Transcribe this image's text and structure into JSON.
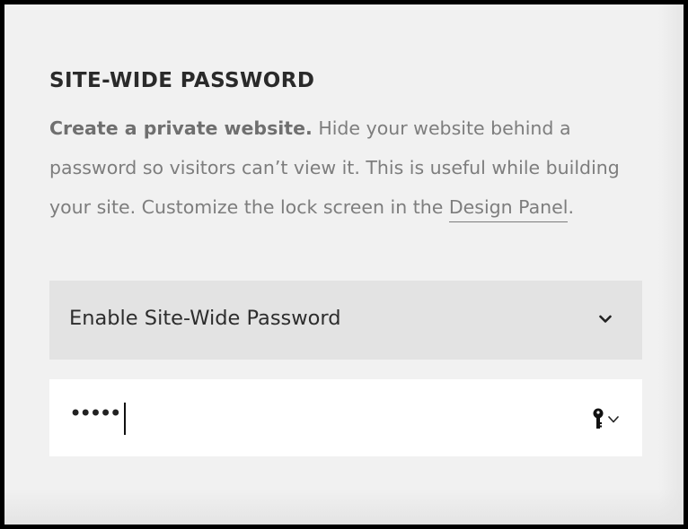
{
  "section": {
    "title": "SITE-WIDE PASSWORD",
    "description_strong": "Create a private website.",
    "description_text": " Hide your website behind a password so visitors can’t view it. This is useful while building your site. Customize the lock screen in the ",
    "description_link": "Design Panel",
    "description_end": "."
  },
  "password_select": {
    "value": "Enable Site-Wide Password",
    "icon": "chevron-down-icon"
  },
  "password_field": {
    "masked_value": "•••••",
    "icon": "key-icon",
    "dropdown_icon": "chevron-down-icon"
  },
  "colors": {
    "background": "#f1f1f1",
    "select_background": "#e3e3e3",
    "field_background": "#ffffff",
    "title_text": "#2a2a2a",
    "body_text": "#7d7d7d"
  }
}
